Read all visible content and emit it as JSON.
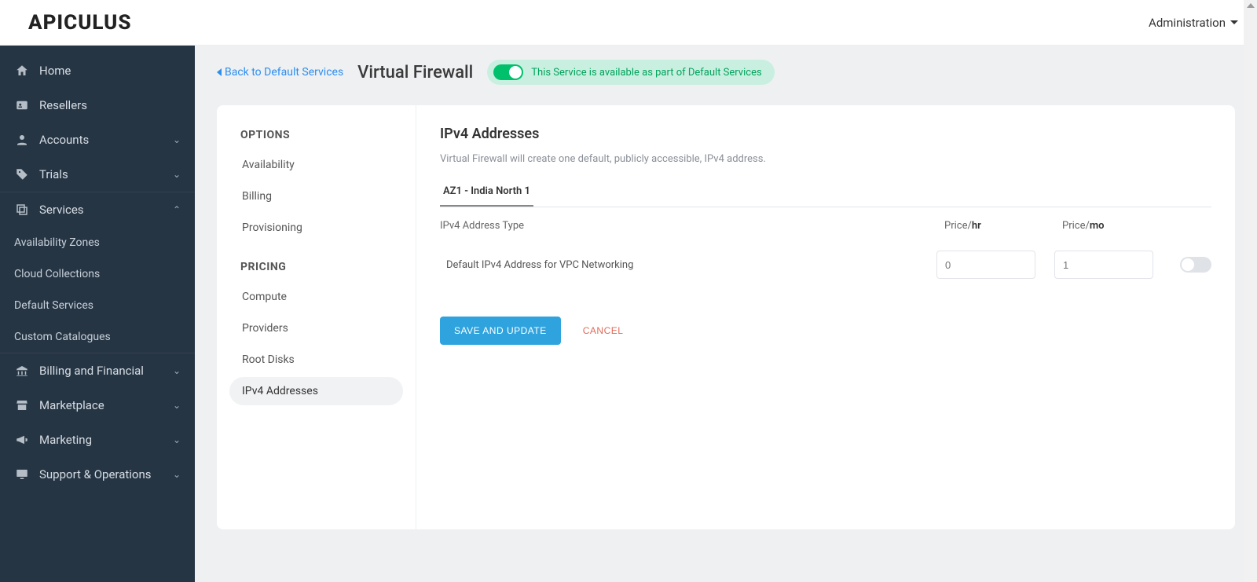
{
  "brand": "APICULUS",
  "topnav": {
    "admin_label": "Administration"
  },
  "sidebar": {
    "home": "Home",
    "resellers": "Resellers",
    "accounts": "Accounts",
    "trials": "Trials",
    "services": "Services",
    "services_children": {
      "availability_zones": "Availability Zones",
      "cloud_collections": "Cloud Collections",
      "default_services": "Default Services",
      "custom_catalogues": "Custom Catalogues"
    },
    "billing_financial": "Billing and Financial",
    "marketplace": "Marketplace",
    "marketing": "Marketing",
    "support_ops": "Support & Operations"
  },
  "page": {
    "back_label": "Back to Default Services",
    "title": "Virtual Firewall",
    "service_badge": "This Service is available as part of Default Services"
  },
  "options": {
    "heading_options": "OPTIONS",
    "heading_pricing": "PRICING",
    "availability": "Availability",
    "billing": "Billing",
    "provisioning": "Provisioning",
    "compute": "Compute",
    "providers": "Providers",
    "root_disks": "Root Disks",
    "ipv4_addresses": "IPv4 Addresses"
  },
  "main": {
    "section_title": "IPv4 Addresses",
    "section_desc": "Virtual Firewall will create one default, publicly accessible, IPv4 address.",
    "tab_label": "AZ1 - India North 1",
    "col_type": "IPv4 Address Type",
    "col_price_prefix": "Price/",
    "col_price_hr_unit": "hr",
    "col_price_mo_unit": "mo",
    "row_label": "Default IPv4 Address for VPC Networking",
    "price_hr_placeholder": "0",
    "price_mo_placeholder": "1",
    "save_label": "SAVE AND UPDATE",
    "cancel_label": "CANCEL"
  }
}
